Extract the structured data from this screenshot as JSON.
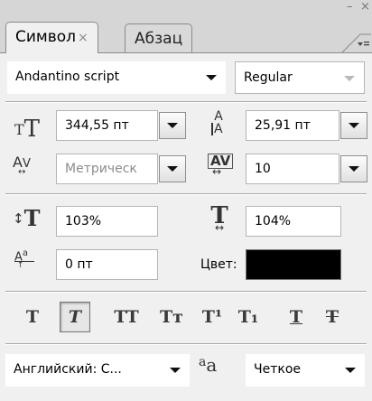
{
  "tabs": [
    {
      "label": "Символ",
      "close": "×",
      "active": true
    },
    {
      "label": "Абзац",
      "active": false
    }
  ],
  "window": {
    "minimize": "–",
    "close": "×",
    "menu": "▾≡"
  },
  "font": {
    "family": "Andantino script",
    "style": "Regular"
  },
  "size": {
    "value": "344,55 пт",
    "icon": "font-size-icon"
  },
  "leading": {
    "value": "25,91 пт",
    "icon": "leading-icon"
  },
  "kerning": {
    "value": "Метрическ",
    "icon": "kerning-icon"
  },
  "tracking": {
    "value": "10",
    "icon": "tracking-icon"
  },
  "vertical_scale": {
    "value": "103%",
    "icon": "vertical-scale-icon"
  },
  "horizontal_scale": {
    "value": "104%",
    "icon": "horizontal-scale-icon"
  },
  "baseline_shift": {
    "value": "0 пт",
    "icon": "baseline-shift-icon"
  },
  "color": {
    "label": "Цвет:",
    "value": "#000000"
  },
  "style_buttons": [
    {
      "glyph": "T",
      "name": "faux-bold"
    },
    {
      "glyph": "T",
      "name": "faux-italic",
      "pressed": true
    },
    {
      "glyph": "TT",
      "name": "all-caps"
    },
    {
      "glyph": "Tт",
      "name": "small-caps"
    },
    {
      "glyph": "T¹",
      "name": "superscript"
    },
    {
      "glyph": "T₁",
      "name": "subscript"
    },
    {
      "glyph": "T",
      "name": "underline"
    },
    {
      "glyph": "T",
      "name": "strikethrough"
    }
  ],
  "language": {
    "value": "Английский: С..."
  },
  "antialias": {
    "icon_text": "aa",
    "value": "Четкое"
  }
}
